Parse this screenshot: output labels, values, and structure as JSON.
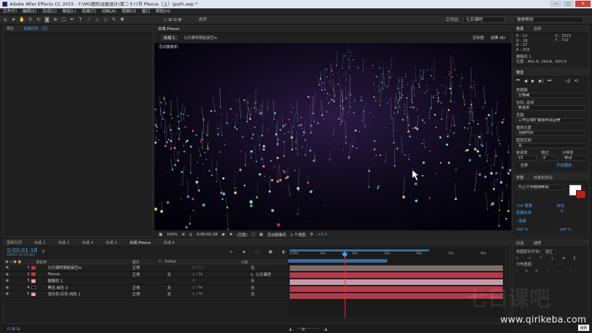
{
  "window": {
    "title": "Adobe After Effects CC 2015 - F:\\MG图形动画设计\\第二十八节 Plexus（上）\\path.aep *",
    "min": "—",
    "max": "□",
    "close": "✕"
  },
  "menu": [
    "文件(F)",
    "编辑(E)",
    "合成(C)",
    "图层(L)",
    "效果(T)",
    "动画(A)",
    "视图(V)",
    "窗口",
    "帮助(H)"
  ],
  "toolbar": {
    "align_label": "对齐",
    "workspace_label": "工作区:",
    "workspace_value": "七日课吧",
    "search_placeholder": "搜索帮助"
  },
  "project_panel": {
    "tab_project": "项目",
    "tab_effects": "效果控件（无）"
  },
  "comp_panel": {
    "tab": "合成 Plexus",
    "sub_tabs": [
      "合成 1",
      "七日课吧阁粘接空w"
    ],
    "renderer_label": "渲染器:",
    "renderer_value": "经典 3D",
    "active_camera": "活动摄像机",
    "bottom": {
      "zoom": "100%",
      "time": "0;00;01;18",
      "res": "(完整)",
      "camera": "活动摄像机",
      "views": "1 个视图",
      "exposure": "+0.0"
    }
  },
  "info_panel": {
    "tab_info": "信息",
    "tab_audio": "音频",
    "r": "R : 12",
    "g": "G : 26",
    "b": "B : 37",
    "a": "A : 255",
    "x": "X : 1521",
    "y": "Y : 710",
    "layer": "摄像机 1",
    "position": "位置 : 481.8, 294.8, -820.6"
  },
  "preview_panel": {
    "tab": "预览",
    "shortcut_label": "快捷键",
    "shortcut_value": "空格键",
    "include_label": "包括: 音频",
    "include_value": "帧速率",
    "range_label": "范围",
    "range_value": "工作区域扩展按时间延伸",
    "play_from_label": "播放位置",
    "play_from_value": "当前时间",
    "fullscreen_label": "图层控制",
    "fullscreen_value": "关",
    "fps_label": "帧速率",
    "skip_label": "跳过",
    "res_label": "分辨率",
    "fps_value": "25",
    "skip_value": "0",
    "res_value": "自动",
    "full_screen": "全屏",
    "cache": "开始播放"
  },
  "char_panel": {
    "tab_char": "字符",
    "tab_para": "效果和预设",
    "font": "方正兰亭超细黑简",
    "size": "110 像素",
    "leading": "自动",
    "tracking": "度量标准",
    "kerning": "0",
    "stroke": "- 像素",
    "scale_v": "100 %",
    "scale_h": "100 %"
  },
  "align_panel": {
    "tab_para": "段落",
    "tab_align": "对齐",
    "align_to": "将图层对齐到:",
    "align_to_value": "选区",
    "distribute": "分布图层:"
  },
  "timeline": {
    "tabs": [
      "渲染队列",
      "合成 1",
      "合成 2",
      "合成 4",
      "合成 3",
      "合成 Plexus",
      "合成 6"
    ],
    "timecode": "0:00:01:18",
    "fps_note": "00043 (25.00 fps)",
    "columns": {
      "name": "源名称",
      "mode": "模式",
      "t": "T",
      "trkmat": "TrkMat",
      "parent": "父级"
    },
    "layers": [
      {
        "num": "1",
        "name": "七日课吧阁粘接空w",
        "mode": "正常",
        "trk": "",
        "parent": "无",
        "color": "#b33a47"
      },
      {
        "num": "2",
        "name": "Plexus",
        "mode": "正常",
        "trk": "无",
        "parent": "1. 七日课吧",
        "color": "#b33a47"
      },
      {
        "num": "3",
        "name": "摄像机 1",
        "mode": "",
        "trk": "",
        "parent": "无",
        "color": "#b33a47"
      },
      {
        "num": "4",
        "name": "黑色 纯色 3",
        "mode": "正常",
        "trk": "无",
        "parent": "无",
        "color": "#b33a47"
      },
      {
        "num": "5",
        "name": "浅灰色-红色 纯色 1",
        "mode": "正常",
        "trk": "无",
        "parent": "无",
        "color": "#b33a47"
      }
    ],
    "ruler": [
      "0:00s",
      "01s",
      "02s",
      "03s",
      "04s",
      "05s",
      "06s"
    ],
    "playhead_seconds": 1.72
  },
  "watermark": {
    "logo": "七日课吧",
    "url": "www.qirikeba.com"
  },
  "overlay_badge": "画板"
}
